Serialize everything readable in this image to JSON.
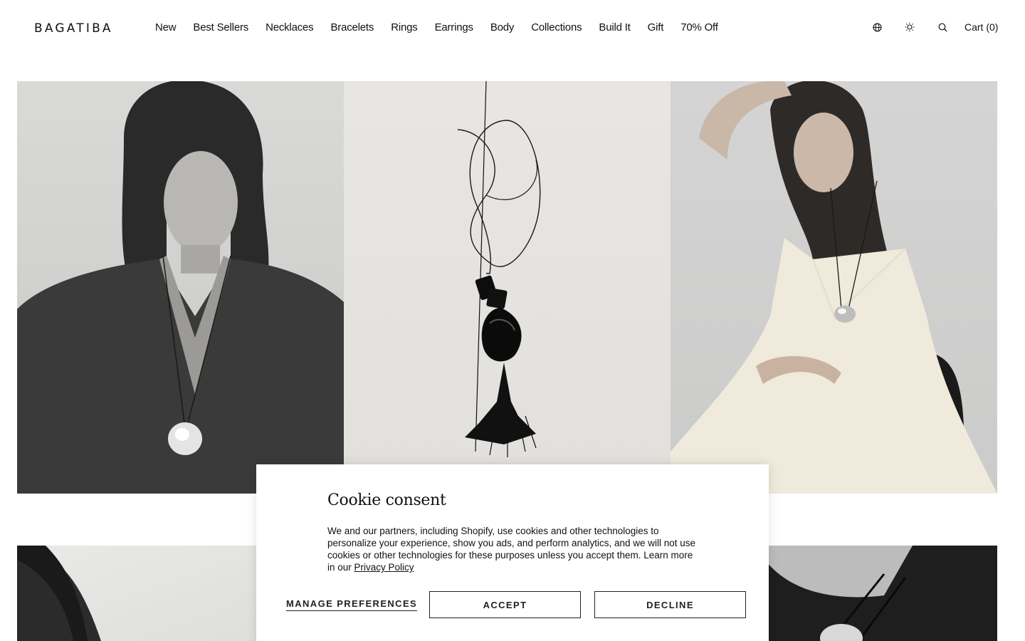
{
  "brand": {
    "logo": "BAGATIBA"
  },
  "nav": {
    "items": [
      "New",
      "Best Sellers",
      "Necklaces",
      "Bracelets",
      "Rings",
      "Earrings",
      "Body",
      "Collections",
      "Build It",
      "Gift",
      "70% Off"
    ]
  },
  "utilities": {
    "icons": [
      "globe-icon",
      "sun-icon",
      "search-icon"
    ],
    "cart_label": "Cart (0)"
  },
  "cookie": {
    "title": "Cookie consent",
    "body": "We and our partners, including Shopify, use cookies and other technologies to personalize your experience, show you ads, and perform analytics, and we will not use cookies or other technologies for these purposes unless you accept them. Learn more in our ",
    "privacy_link": "Privacy Policy",
    "manage_label": "MANAGE PREFERENCES",
    "accept_label": "ACCEPT",
    "decline_label": "DECLINE"
  }
}
